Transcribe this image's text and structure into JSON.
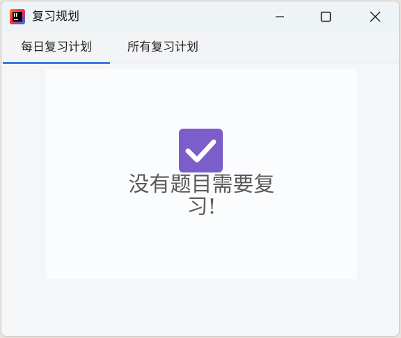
{
  "window": {
    "title": "复习规划",
    "icon": "intellij-app-icon",
    "controls": [
      "minimize-icon",
      "maximize-icon",
      "close-icon"
    ]
  },
  "tabs": [
    {
      "label": "每日复习计划",
      "active": true
    },
    {
      "label": "所有复习计划",
      "active": false
    }
  ],
  "main": {
    "icon": "checkbox-checked-icon",
    "message": "没有题目需要复习!"
  },
  "colors": {
    "accent": "#3d7be0",
    "check_bg": "#7b5ec9",
    "text": "#5a5a5a"
  }
}
